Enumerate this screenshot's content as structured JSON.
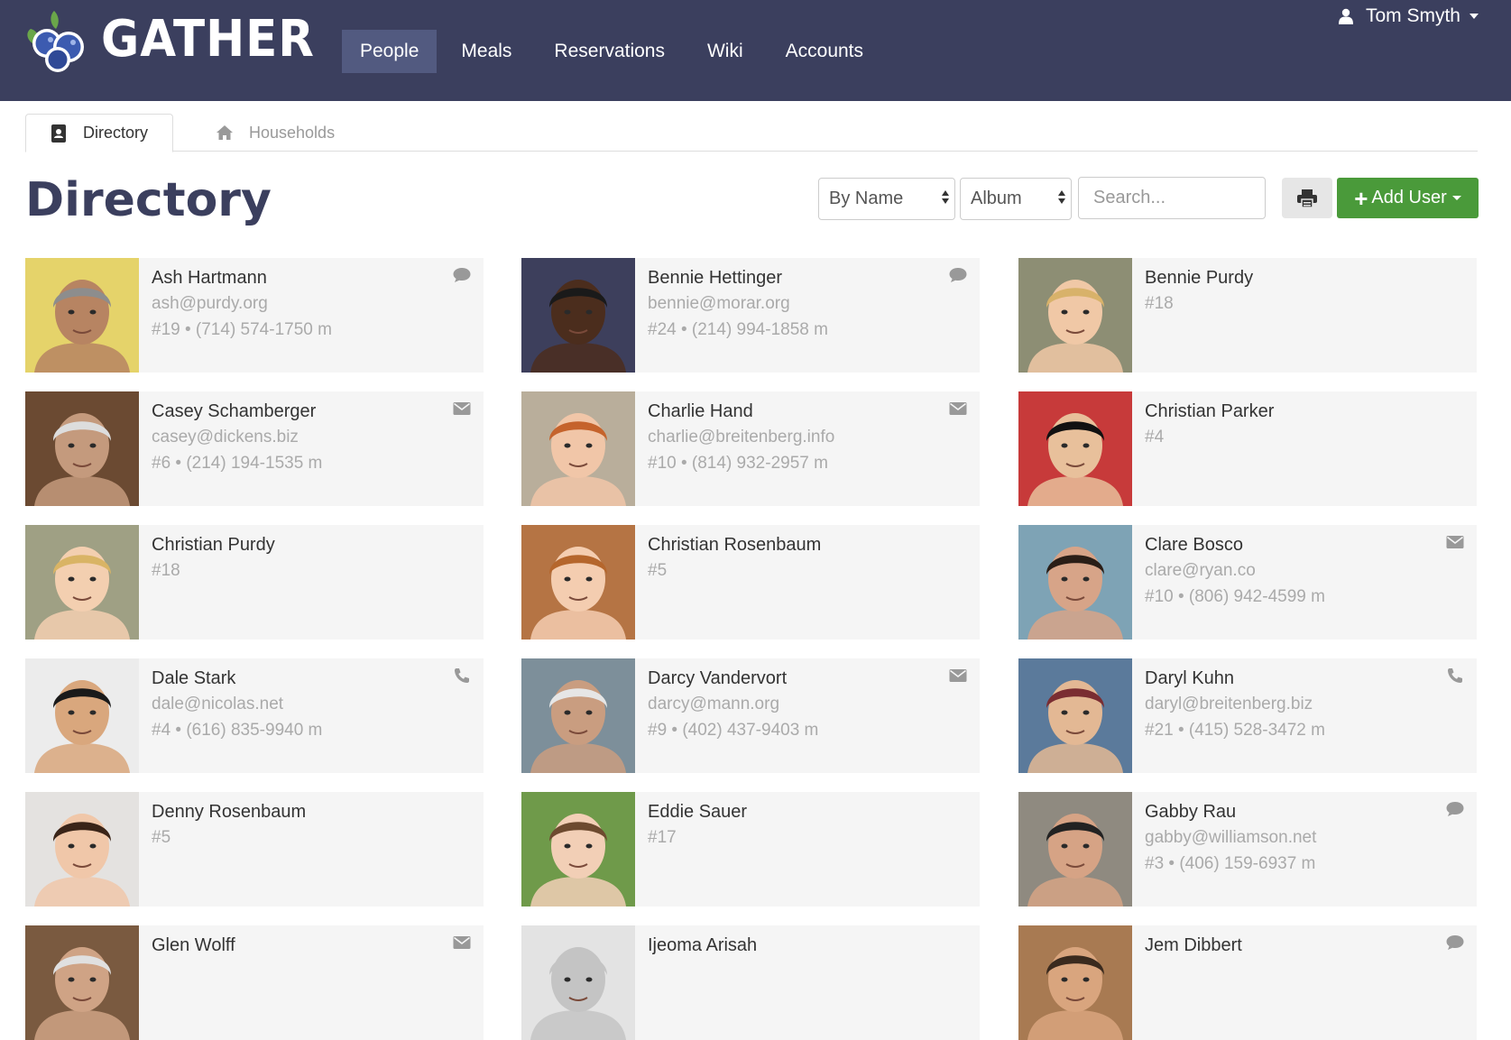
{
  "app": {
    "name": "GATHER"
  },
  "nav": {
    "items": [
      {
        "label": "People",
        "active": true
      },
      {
        "label": "Meals",
        "active": false
      },
      {
        "label": "Reservations",
        "active": false
      },
      {
        "label": "Wiki",
        "active": false
      },
      {
        "label": "Accounts",
        "active": false
      }
    ]
  },
  "user": {
    "name": "Tom Smyth"
  },
  "tabs": [
    {
      "label": "Directory",
      "icon": "address-book-icon",
      "active": true
    },
    {
      "label": "Households",
      "icon": "home-icon",
      "active": false
    }
  ],
  "page": {
    "title": "Directory"
  },
  "controls": {
    "sort": {
      "value": "By Name"
    },
    "view": {
      "value": "Album"
    },
    "search": {
      "placeholder": "Search..."
    },
    "add_user_label": "Add User"
  },
  "colors": {
    "navbar": "#3b3f5e",
    "accent": "#4a9a3a",
    "card": "#f5f5f5"
  },
  "people": [
    {
      "name": "Ash Hartmann",
      "email": "ash@purdy.org",
      "meta": "#19 • (714) 574-1750 m",
      "contact_icon": "chat-icon",
      "photo_bg": "#e5d36a",
      "skin": "#b78462",
      "hair": "#8d8d8d"
    },
    {
      "name": "Bennie Hettinger",
      "email": "bennie@morar.org",
      "meta": "#24 • (214) 994-1858 m",
      "contact_icon": "chat-icon",
      "photo_bg": "#3d3f5c",
      "skin": "#4b2d1d",
      "hair": "#1a1a1a"
    },
    {
      "name": "Bennie Purdy",
      "email": "",
      "meta": "#18",
      "contact_icon": "",
      "photo_bg": "#8d8e74",
      "skin": "#f0c8a6",
      "hair": "#d8b26a"
    },
    {
      "name": "Casey Schamberger",
      "email": "casey@dickens.biz",
      "meta": "#6 • (214) 194-1535 m",
      "contact_icon": "envelope-icon",
      "photo_bg": "#6b4a32",
      "skin": "#c49a7d",
      "hair": "#dddddd"
    },
    {
      "name": "Charlie Hand",
      "email": "charlie@breitenberg.info",
      "meta": "#10 • (814) 932-2957 m",
      "contact_icon": "envelope-icon",
      "photo_bg": "#b9ae9b",
      "skin": "#f1c6a8",
      "hair": "#c5632c"
    },
    {
      "name": "Christian Parker",
      "email": "",
      "meta": "#4",
      "contact_icon": "",
      "photo_bg": "#c73a3a",
      "skin": "#e8c09b",
      "hair": "#111111"
    },
    {
      "name": "Christian Purdy",
      "email": "",
      "meta": "#18",
      "contact_icon": "",
      "photo_bg": "#9fa084",
      "skin": "#f3cfb0",
      "hair": "#d9b465"
    },
    {
      "name": "Christian Rosenbaum",
      "email": "",
      "meta": "#5",
      "contact_icon": "",
      "photo_bg": "#b57444",
      "skin": "#f4cdb0",
      "hair": "#b5662c"
    },
    {
      "name": "Clare Bosco",
      "email": "clare@ryan.co",
      "meta": "#10 • (806) 942-4599 m",
      "contact_icon": "envelope-icon",
      "photo_bg": "#7ea3b5",
      "skin": "#d7a488",
      "hair": "#2a1e17"
    },
    {
      "name": "Dale Stark",
      "email": "dale@nicolas.net",
      "meta": "#4 • (616) 835-9940 m",
      "contact_icon": "phone-icon",
      "photo_bg": "#ececec",
      "skin": "#d9a77d",
      "hair": "#1a1a1a"
    },
    {
      "name": "Darcy Vandervort",
      "email": "darcy@mann.org",
      "meta": "#9 • (402) 437-9403 m",
      "contact_icon": "envelope-icon",
      "photo_bg": "#7d8f9a",
      "skin": "#c99d80",
      "hair": "#e6e6e6"
    },
    {
      "name": "Daryl Kuhn",
      "email": "daryl@breitenberg.biz",
      "meta": "#21 • (415) 528-3472 m",
      "contact_icon": "phone-icon",
      "photo_bg": "#5b7a9b",
      "skin": "#e3b894",
      "hair": "#7a2d32"
    },
    {
      "name": "Denny Rosenbaum",
      "email": "",
      "meta": "#5",
      "contact_icon": "",
      "photo_bg": "#e4e2e0",
      "skin": "#f0c7a9",
      "hair": "#3a2418"
    },
    {
      "name": "Eddie Sauer",
      "email": "",
      "meta": "#17",
      "contact_icon": "",
      "photo_bg": "#6f9a4a",
      "skin": "#f2cfb6",
      "hair": "#6d4a2f"
    },
    {
      "name": "Gabby Rau",
      "email": "gabby@williamson.net",
      "meta": "#3 • (406) 159-6937 m",
      "contact_icon": "chat-icon",
      "photo_bg": "#8f8a80",
      "skin": "#d6a385",
      "hair": "#222222"
    },
    {
      "name": "Glen Wolff",
      "email": "",
      "meta": "",
      "contact_icon": "envelope-icon",
      "photo_bg": "#7a5a40",
      "skin": "#cfa385",
      "hair": "#e0e0e0"
    },
    {
      "name": "Ijeoma Arisah",
      "email": "",
      "meta": "",
      "contact_icon": "",
      "photo_bg": "#e3e3e3",
      "skin": "#c4c4c4",
      "hair": "#c4c4c4"
    },
    {
      "name": "Jem Dibbert",
      "email": "",
      "meta": "",
      "contact_icon": "chat-icon",
      "photo_bg": "#a87a52",
      "skin": "#d9a57e",
      "hair": "#3a2a1e"
    }
  ]
}
